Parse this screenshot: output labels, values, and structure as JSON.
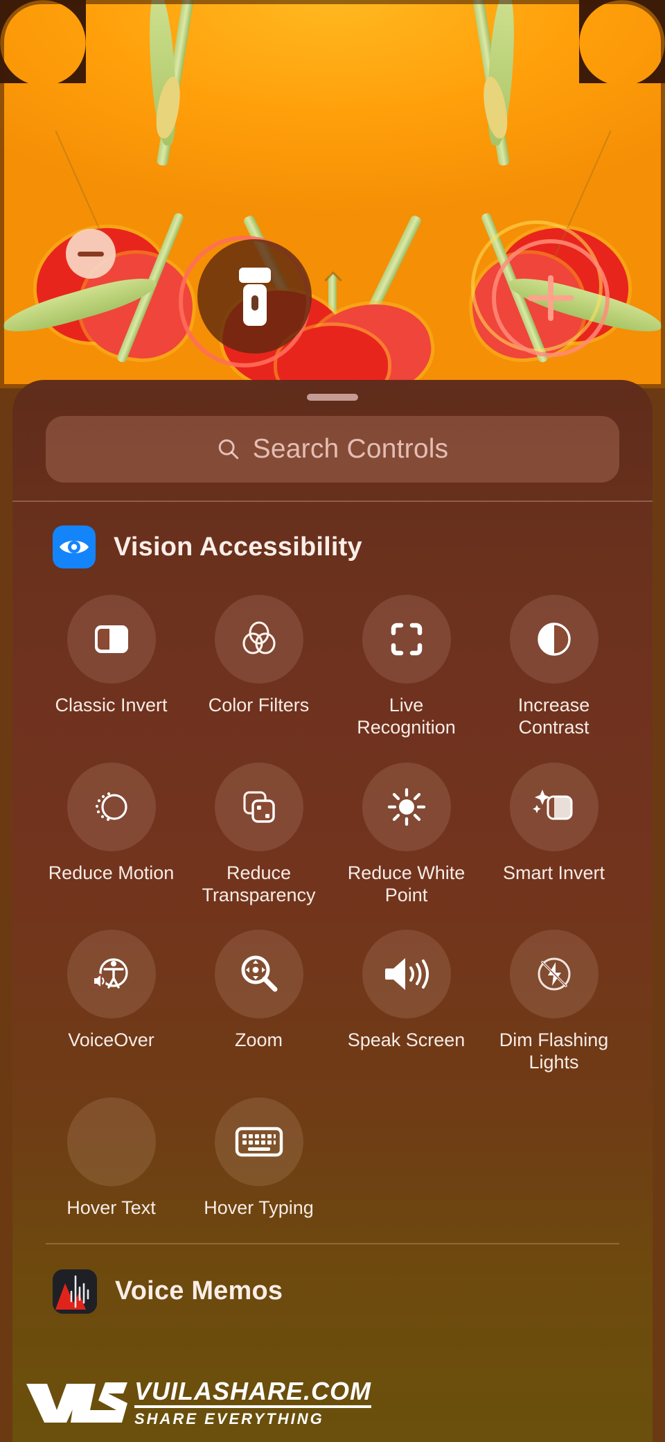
{
  "wallpaper": {
    "edit_mode_controls": [
      {
        "name": "flashlight",
        "badge": "minus",
        "badge_label": "Remove control"
      },
      {
        "name": "add-control",
        "badge": "plus",
        "badge_label": "Add control"
      }
    ]
  },
  "sheet": {
    "drag_handle_label": "Drag handle",
    "search": {
      "icon": "search-icon",
      "placeholder": "Search Controls",
      "value": ""
    },
    "sections": [
      {
        "id": "vision-accessibility",
        "title": "Vision Accessibility",
        "icon": "eye-icon",
        "icon_color": "#1484fb",
        "controls": [
          {
            "label": "Classic Invert",
            "icon": "classic-invert-icon",
            "has_icon": true
          },
          {
            "label": "Color Filters",
            "icon": "color-filters-icon",
            "has_icon": true
          },
          {
            "label": "Live Recognition",
            "icon": "live-recognition-icon",
            "has_icon": true
          },
          {
            "label": "Increase Contrast",
            "icon": "increase-contrast-icon",
            "has_icon": true
          },
          {
            "label": "Reduce Motion",
            "icon": "reduce-motion-icon",
            "has_icon": true
          },
          {
            "label": "Reduce Transparency",
            "icon": "reduce-transparency-icon",
            "has_icon": true
          },
          {
            "label": "Reduce White Point",
            "icon": "reduce-white-point-icon",
            "has_icon": true
          },
          {
            "label": "Smart Invert",
            "icon": "smart-invert-icon",
            "has_icon": true
          },
          {
            "label": "VoiceOver",
            "icon": "voiceover-icon",
            "has_icon": true
          },
          {
            "label": "Zoom",
            "icon": "zoom-icon",
            "has_icon": true
          },
          {
            "label": "Speak Screen",
            "icon": "speak-screen-icon",
            "has_icon": true
          },
          {
            "label": "Dim Flashing Lights",
            "icon": "dim-flashing-lights-icon",
            "has_icon": true
          },
          {
            "label": "Hover Text",
            "icon": "hover-text-icon",
            "has_icon": false
          },
          {
            "label": "Hover Typing",
            "icon": "hover-typing-icon",
            "has_icon": true
          }
        ]
      },
      {
        "id": "voice-memos",
        "title": "Voice Memos",
        "icon": "voice-memos-app-icon",
        "controls": []
      }
    ]
  },
  "watermark": {
    "logo": "VLS",
    "line1": "VUILASHARE.COM",
    "line2": "SHARE EVERYTHING"
  },
  "colors": {
    "accent_blue": "#1484fb",
    "sheet_top": "#5e2c1c",
    "sheet_bottom": "#6a520c",
    "wallpaper_orange": "#ff9f0a",
    "petal_red": "#e8251c",
    "stem_green": "#c4d98a",
    "label_text": "#f7ece6",
    "placeholder_text": "#ffded7"
  }
}
